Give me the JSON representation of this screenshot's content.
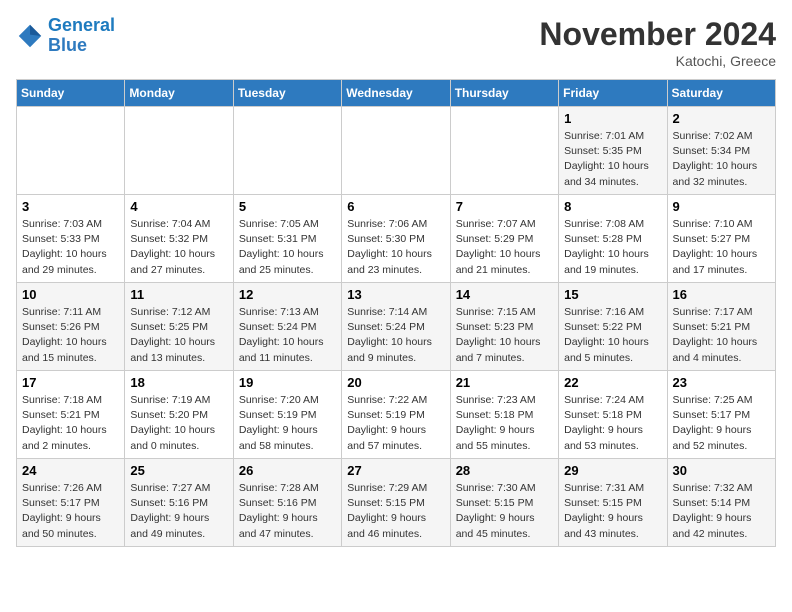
{
  "header": {
    "logo_line1": "General",
    "logo_line2": "Blue",
    "month": "November 2024",
    "location": "Katochi, Greece"
  },
  "weekdays": [
    "Sunday",
    "Monday",
    "Tuesday",
    "Wednesday",
    "Thursday",
    "Friday",
    "Saturday"
  ],
  "weeks": [
    [
      {
        "day": "",
        "info": ""
      },
      {
        "day": "",
        "info": ""
      },
      {
        "day": "",
        "info": ""
      },
      {
        "day": "",
        "info": ""
      },
      {
        "day": "",
        "info": ""
      },
      {
        "day": "1",
        "info": "Sunrise: 7:01 AM\nSunset: 5:35 PM\nDaylight: 10 hours\nand 34 minutes."
      },
      {
        "day": "2",
        "info": "Sunrise: 7:02 AM\nSunset: 5:34 PM\nDaylight: 10 hours\nand 32 minutes."
      }
    ],
    [
      {
        "day": "3",
        "info": "Sunrise: 7:03 AM\nSunset: 5:33 PM\nDaylight: 10 hours\nand 29 minutes."
      },
      {
        "day": "4",
        "info": "Sunrise: 7:04 AM\nSunset: 5:32 PM\nDaylight: 10 hours\nand 27 minutes."
      },
      {
        "day": "5",
        "info": "Sunrise: 7:05 AM\nSunset: 5:31 PM\nDaylight: 10 hours\nand 25 minutes."
      },
      {
        "day": "6",
        "info": "Sunrise: 7:06 AM\nSunset: 5:30 PM\nDaylight: 10 hours\nand 23 minutes."
      },
      {
        "day": "7",
        "info": "Sunrise: 7:07 AM\nSunset: 5:29 PM\nDaylight: 10 hours\nand 21 minutes."
      },
      {
        "day": "8",
        "info": "Sunrise: 7:08 AM\nSunset: 5:28 PM\nDaylight: 10 hours\nand 19 minutes."
      },
      {
        "day": "9",
        "info": "Sunrise: 7:10 AM\nSunset: 5:27 PM\nDaylight: 10 hours\nand 17 minutes."
      }
    ],
    [
      {
        "day": "10",
        "info": "Sunrise: 7:11 AM\nSunset: 5:26 PM\nDaylight: 10 hours\nand 15 minutes."
      },
      {
        "day": "11",
        "info": "Sunrise: 7:12 AM\nSunset: 5:25 PM\nDaylight: 10 hours\nand 13 minutes."
      },
      {
        "day": "12",
        "info": "Sunrise: 7:13 AM\nSunset: 5:24 PM\nDaylight: 10 hours\nand 11 minutes."
      },
      {
        "day": "13",
        "info": "Sunrise: 7:14 AM\nSunset: 5:24 PM\nDaylight: 10 hours\nand 9 minutes."
      },
      {
        "day": "14",
        "info": "Sunrise: 7:15 AM\nSunset: 5:23 PM\nDaylight: 10 hours\nand 7 minutes."
      },
      {
        "day": "15",
        "info": "Sunrise: 7:16 AM\nSunset: 5:22 PM\nDaylight: 10 hours\nand 5 minutes."
      },
      {
        "day": "16",
        "info": "Sunrise: 7:17 AM\nSunset: 5:21 PM\nDaylight: 10 hours\nand 4 minutes."
      }
    ],
    [
      {
        "day": "17",
        "info": "Sunrise: 7:18 AM\nSunset: 5:21 PM\nDaylight: 10 hours\nand 2 minutes."
      },
      {
        "day": "18",
        "info": "Sunrise: 7:19 AM\nSunset: 5:20 PM\nDaylight: 10 hours\nand 0 minutes."
      },
      {
        "day": "19",
        "info": "Sunrise: 7:20 AM\nSunset: 5:19 PM\nDaylight: 9 hours\nand 58 minutes."
      },
      {
        "day": "20",
        "info": "Sunrise: 7:22 AM\nSunset: 5:19 PM\nDaylight: 9 hours\nand 57 minutes."
      },
      {
        "day": "21",
        "info": "Sunrise: 7:23 AM\nSunset: 5:18 PM\nDaylight: 9 hours\nand 55 minutes."
      },
      {
        "day": "22",
        "info": "Sunrise: 7:24 AM\nSunset: 5:18 PM\nDaylight: 9 hours\nand 53 minutes."
      },
      {
        "day": "23",
        "info": "Sunrise: 7:25 AM\nSunset: 5:17 PM\nDaylight: 9 hours\nand 52 minutes."
      }
    ],
    [
      {
        "day": "24",
        "info": "Sunrise: 7:26 AM\nSunset: 5:17 PM\nDaylight: 9 hours\nand 50 minutes."
      },
      {
        "day": "25",
        "info": "Sunrise: 7:27 AM\nSunset: 5:16 PM\nDaylight: 9 hours\nand 49 minutes."
      },
      {
        "day": "26",
        "info": "Sunrise: 7:28 AM\nSunset: 5:16 PM\nDaylight: 9 hours\nand 47 minutes."
      },
      {
        "day": "27",
        "info": "Sunrise: 7:29 AM\nSunset: 5:15 PM\nDaylight: 9 hours\nand 46 minutes."
      },
      {
        "day": "28",
        "info": "Sunrise: 7:30 AM\nSunset: 5:15 PM\nDaylight: 9 hours\nand 45 minutes."
      },
      {
        "day": "29",
        "info": "Sunrise: 7:31 AM\nSunset: 5:15 PM\nDaylight: 9 hours\nand 43 minutes."
      },
      {
        "day": "30",
        "info": "Sunrise: 7:32 AM\nSunset: 5:14 PM\nDaylight: 9 hours\nand 42 minutes."
      }
    ]
  ]
}
